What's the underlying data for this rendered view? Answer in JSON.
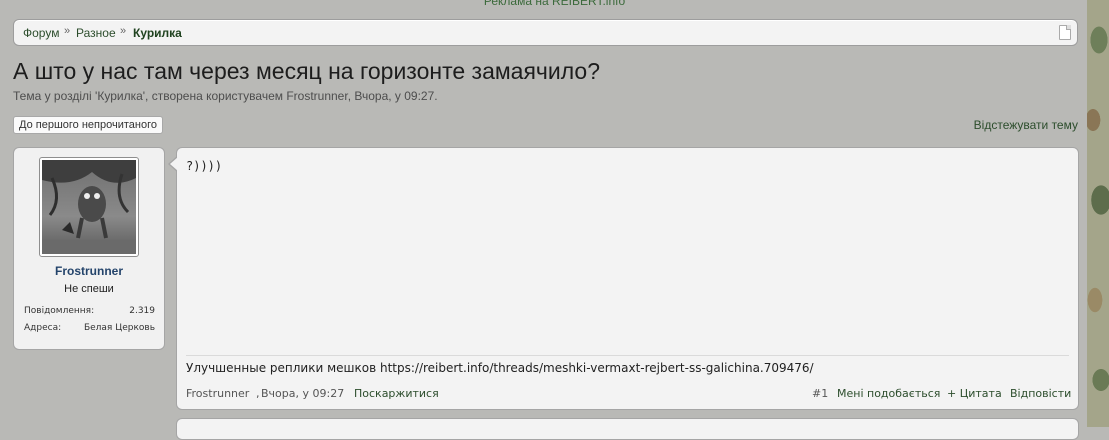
{
  "ad_text": "Реклама на REIBERT.info",
  "breadcrumb": {
    "items": [
      "Форум",
      "Разное",
      "Курилка"
    ],
    "separator": "»"
  },
  "thread": {
    "title": "А што у нас там через месяц на горизонте замаячило?",
    "subtitle": "Тема у розділі 'Курилка', створена користувачем Frostrunner, Вчора, у 09:27."
  },
  "actions": {
    "first_unread": "До першого непрочитаного",
    "watch": "Відстежувати тему"
  },
  "user": {
    "name": "Frostrunner",
    "title": "Не спеши",
    "stats": [
      {
        "label": "Повідомлення:",
        "value": "2.319"
      },
      {
        "label": "Адреса:",
        "value": "Белая Церковь"
      }
    ]
  },
  "post": {
    "body": "?))))",
    "signature": "Улучшенные реплики мешков https://reibert.info/threads/meshki-vermaxt-rejbert-ss-galichina.709476/",
    "author": "Frostrunner",
    "date": "Вчора, у 09:27",
    "report": "Поскаржитися",
    "number": "#1",
    "like": "Мені подобається",
    "quote": "+ Цитата",
    "reply": "Відповісти"
  },
  "colors": {
    "background": "#b9b9b6",
    "panel": "#f3f3f3",
    "link": "#2c4d2c",
    "username": "#24446b"
  }
}
